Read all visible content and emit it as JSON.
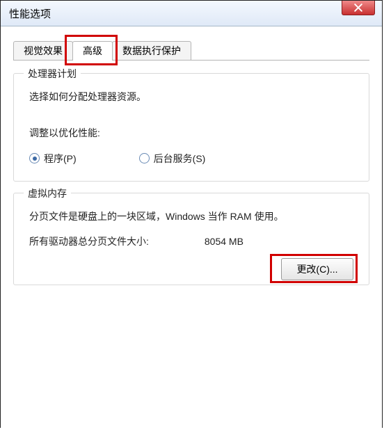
{
  "window": {
    "title": "性能选项"
  },
  "tabs": [
    {
      "label": "视觉效果"
    },
    {
      "label": "高级"
    },
    {
      "label": "数据执行保护"
    }
  ],
  "active_tab_index": 1,
  "processor_scheduling": {
    "legend": "处理器计划",
    "description": "选择如何分配处理器资源。",
    "adjust_label": "调整以优化性能:",
    "options": {
      "programs": "程序(P)",
      "background": "后台服务(S)"
    },
    "selected": "programs"
  },
  "virtual_memory": {
    "legend": "虚拟内存",
    "description": "分页文件是硬盘上的一块区域，Windows 当作 RAM 使用。",
    "total_label": "所有驱动器总分页文件大小:",
    "total_value": "8054 MB",
    "change_button": "更改(C)..."
  }
}
